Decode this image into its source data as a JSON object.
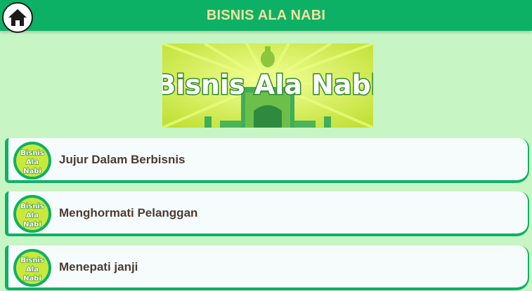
{
  "app_bar": {
    "title": "BISNIS ALA NABI",
    "home_icon": "home-icon"
  },
  "banner": {
    "text": "Bisnis Ala Nabi",
    "colors": {
      "bg": "#c9e83a",
      "mosque": "#3fae5a",
      "dome": "#8cc63f",
      "text_fill": "#ffffff",
      "text_stroke": "#2f8a2f"
    }
  },
  "list": {
    "items": [
      {
        "label": "Jujur Dalam Berbisnis",
        "thumb_text": [
          "Bisnis",
          "Ala",
          "Nabi"
        ]
      },
      {
        "label": "Menghormati Pelanggan",
        "thumb_text": [
          "Bisnis",
          "Ala",
          "Nabi"
        ]
      },
      {
        "label": "Menepati janji",
        "thumb_text": [
          "Bisnis",
          "Ala",
          "Nabi"
        ]
      }
    ]
  },
  "colors": {
    "accent": "#0db166",
    "background": "#c8f5c4",
    "title_text": "#f0e2a0",
    "item_text": "#4a3b33"
  }
}
